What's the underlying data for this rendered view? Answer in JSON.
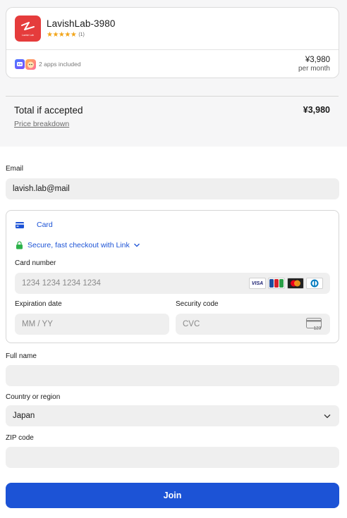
{
  "product": {
    "name": "LavishLab-3980",
    "logo_text": "Lavish Lab",
    "rating": 5,
    "stars": "★★★★★",
    "rating_count": "(1)",
    "apps_included": "2 apps included",
    "price": "¥3,980",
    "period": "per month"
  },
  "summary": {
    "total_label": "Total if accepted",
    "total_value": "¥3,980",
    "breakdown_link": "Price breakdown"
  },
  "form": {
    "email_label": "Email",
    "email_value": "lavish.lab@mail",
    "card_tab_label": "Card",
    "link_text": "Secure, fast checkout with Link",
    "card_number_label": "Card number",
    "card_number_placeholder": "1234 1234 1234 1234",
    "brands": [
      "VISA",
      "JCB",
      "Mastercard",
      "Diners"
    ],
    "expiration_label": "Expiration date",
    "expiration_placeholder": "MM / YY",
    "security_label": "Security code",
    "security_placeholder": "CVC",
    "cvc_icon_text": "123",
    "full_name_label": "Full name",
    "full_name_value": "",
    "country_label": "Country or region",
    "country_value": "Japan",
    "zip_label": "ZIP code",
    "zip_value": "",
    "submit_label": "Join"
  },
  "colors": {
    "accent": "#1c53d6",
    "logo_bg": "#e53c3c",
    "star": "#f2a51a",
    "link_green": "#2db24a"
  }
}
